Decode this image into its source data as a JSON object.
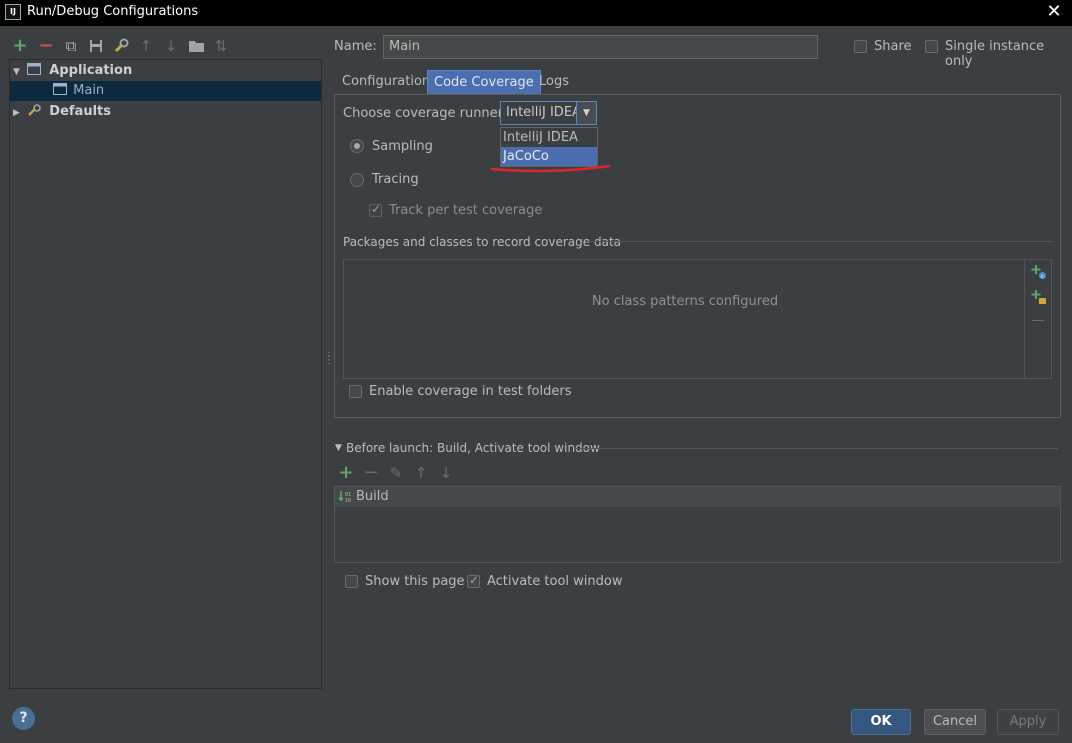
{
  "window": {
    "title": "Run/Debug Configurations",
    "app_icon": "IJ",
    "close_icon": "✕"
  },
  "toolbar": {
    "add": "+",
    "remove": "−",
    "copy": "⧉",
    "save": "💾",
    "edit_defaults": "🔧",
    "move_up": "↑",
    "move_down": "↓",
    "folder": "▬",
    "sort": "⇅"
  },
  "tree": {
    "items": [
      {
        "label": "Application",
        "expanded": true
      },
      {
        "label": "Main",
        "selected": true
      },
      {
        "label": "Defaults",
        "expanded": false
      }
    ]
  },
  "form": {
    "name_label": "Name:",
    "name_value": "Main",
    "share_label": "Share",
    "single_instance_label": "Single instance only"
  },
  "tabs": [
    {
      "label": "Configuration"
    },
    {
      "label": "Code Coverage",
      "active": true
    },
    {
      "label": "Logs"
    }
  ],
  "coverage": {
    "runner_label": "Choose coverage runner:",
    "runner_value": "IntelliJ IDEA",
    "runner_options": [
      "IntelliJ IDEA",
      "JaCoCo"
    ],
    "highlight_color": "#e0242b",
    "sampling_label": "Sampling",
    "tracing_label": "Tracing",
    "track_label": "Track per test coverage",
    "packages_label": "Packages and classes to record coverage data",
    "empty_text": "No class patterns configured",
    "enable_test_folders_label": "Enable coverage in test folders"
  },
  "before_launch": {
    "header": "Before launch: Build, Activate tool window",
    "items": [
      "Build"
    ],
    "show_page_label": "Show this page",
    "activate_label": "Activate tool window"
  },
  "buttons": {
    "ok": "OK",
    "cancel": "Cancel",
    "apply": "Apply",
    "help": "?"
  }
}
